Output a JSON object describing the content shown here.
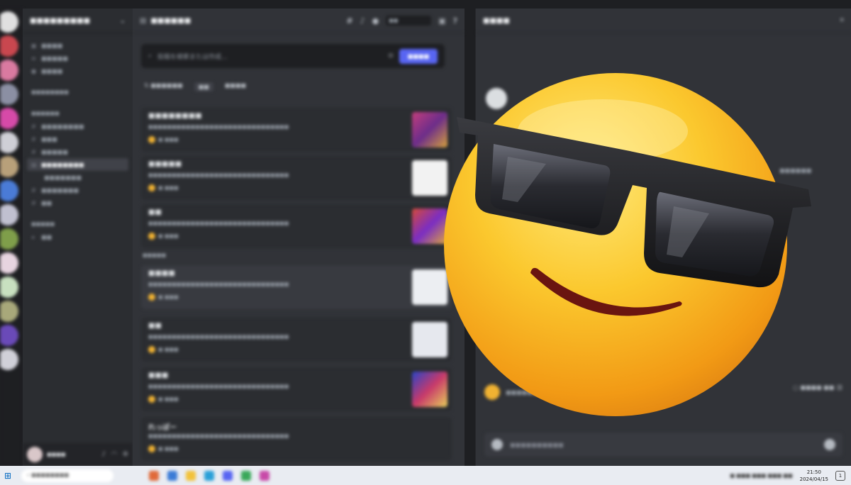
{
  "channel_sidebar": {
    "server_name": "",
    "channels": [
      {
        "label": ""
      },
      {
        "label": ""
      },
      {
        "label": ""
      }
    ]
  },
  "forum": {
    "channel_name": "",
    "search_placeholder": "投稿を検索または作成...",
    "new_post_label": "",
    "posts": [
      {
        "title": "",
        "snippet": "",
        "meta": ""
      },
      {
        "title": "",
        "snippet": "",
        "meta": ""
      },
      {
        "title": "",
        "snippet": "",
        "meta": ""
      },
      {
        "title": "",
        "snippet": "",
        "meta": ""
      },
      {
        "title": "",
        "snippet": "",
        "meta": ""
      },
      {
        "title": "",
        "snippet": "",
        "meta": ""
      },
      {
        "title": "れっぽー",
        "snippet": "",
        "meta": ""
      }
    ]
  },
  "right_pane": {
    "title": ""
  },
  "taskbar": {
    "time": "21:50",
    "date": "2024/04/15",
    "notification_count": "1"
  },
  "overlay": {
    "emoji_name": "smiling face with sunglasses"
  },
  "colors": {
    "accent": "#5865f2",
    "background": "#313338",
    "sidebar": "#2b2d31",
    "emoji_yellow": "#f6c12a"
  }
}
